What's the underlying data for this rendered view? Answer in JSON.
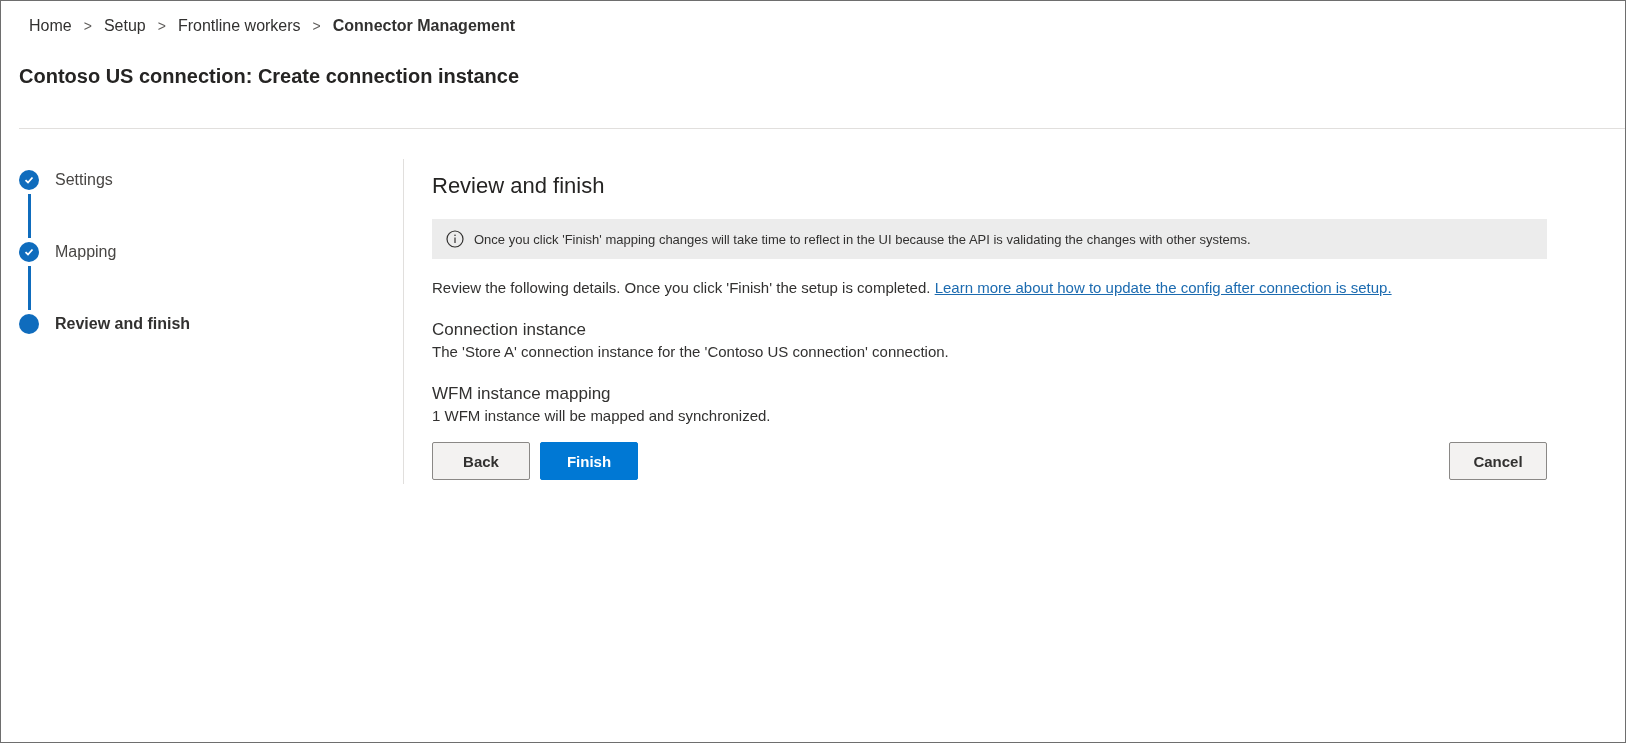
{
  "breadcrumb": [
    {
      "label": "Home",
      "current": false
    },
    {
      "label": "Setup",
      "current": false
    },
    {
      "label": "Frontline workers",
      "current": false
    },
    {
      "label": "Connector Management",
      "current": true
    }
  ],
  "separator": ">",
  "page_title": "Contoso US connection: Create connection instance",
  "steps": [
    {
      "label": "Settings",
      "completed": true,
      "selected": false
    },
    {
      "label": "Mapping",
      "completed": true,
      "selected": false
    },
    {
      "label": "Review and finish",
      "completed": false,
      "selected": true
    }
  ],
  "panel": {
    "heading": "Review and finish",
    "info": "Once you click 'Finish' mapping changes will take time to reflect in the UI because the API is validating the changes with other systems.",
    "intro": "Review the following details. Once you click 'Finish' the setup is completed.",
    "link": "Learn more about how to update the config after connection is setup.",
    "sections": [
      {
        "heading": "Connection instance",
        "text": "The 'Store A' connection instance for the 'Contoso US connection' connection."
      },
      {
        "heading": "WFM instance mapping",
        "text": "1 WFM instance will be mapped and synchronized."
      }
    ],
    "buttons": [
      {
        "label": "Back",
        "kind": "default"
      },
      {
        "label": "Finish",
        "kind": "primary"
      }
    ],
    "cancel": "Cancel"
  }
}
